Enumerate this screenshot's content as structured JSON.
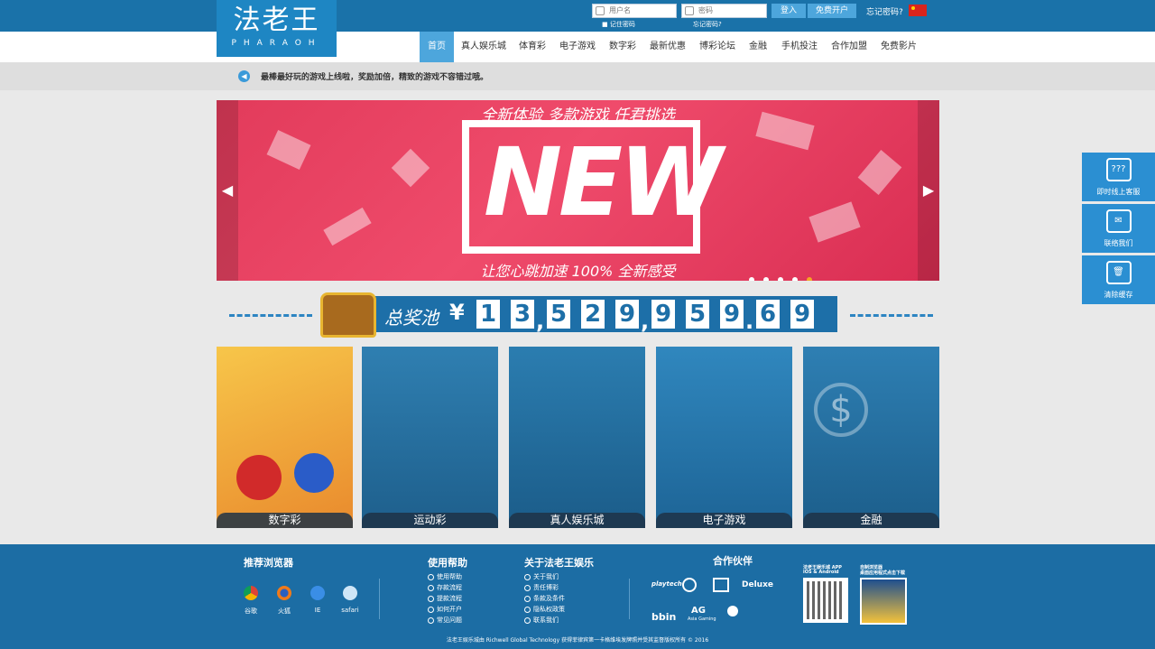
{
  "header": {
    "logo_cn": "法老王",
    "logo_en": "PHARAOH",
    "username_placeholder": "用户名",
    "password_placeholder": "密码",
    "remember": "记住密码",
    "forgot_small": "忘记密码?",
    "login": "登入",
    "register": "免费开户",
    "forgot": "忘记密码?"
  },
  "nav": [
    "首页",
    "真人娱乐城",
    "体育彩",
    "电子游戏",
    "数字彩",
    "最新优惠",
    "博彩论坛",
    "金融",
    "手机投注",
    "合作加盟",
    "免费影片"
  ],
  "notice": "最棒最好玩的游戏上线啦，奖励加倍，精致的游戏不容错过哦。",
  "banner": {
    "slogan_top": "全新体验 多款游戏 任君挑选",
    "big": "NEW",
    "slogan_bottom": "让您心跳加速 100% 全新感受",
    "slides": 5,
    "active_slide": 5
  },
  "jackpot": {
    "label": "总奖池",
    "currency": "¥",
    "digits": [
      "1",
      "3",
      "5",
      "2",
      "9",
      "9",
      "5",
      "9",
      "6",
      "9"
    ],
    "sep1": ",",
    "sep2": ",",
    "sep3": "."
  },
  "categories": [
    "数字彩",
    "运动彩",
    "真人娱乐城",
    "电子游戏",
    "金融"
  ],
  "sidebar": [
    "即时线上客服",
    "联络我们",
    "清除缓存"
  ],
  "footer": {
    "browsers_title": "推荐浏览器",
    "browsers": [
      "谷歌",
      "火狐",
      "IE",
      "safari"
    ],
    "help_title": "使用帮助",
    "help": [
      "使用帮助",
      "存款流程",
      "提款流程",
      "如何开户",
      "常见问题"
    ],
    "about_title": "关于法老王娱乐",
    "about": [
      "关于我们",
      "责任博彩",
      "条款及条件",
      "隐私权政策",
      "联系我们"
    ],
    "partners_title": "合作伙伴",
    "partners": [
      "playtech",
      "",
      "",
      "Deluxe",
      "bbin",
      "AG",
      "Asia Gaming"
    ],
    "app_text1": "法老王娱乐城 APP",
    "app_text2": "iOS & Android",
    "app2_text1": "自制浏览器",
    "app2_text2": "桌面应用程式点击下载",
    "copyright": "法老王娱乐城由 Richwell Global Technology 获得菲律宾第一卡格维埃发牌照并受其监督版权所有 © 2016",
    "colors": {
      "bg": "#1c6da4",
      "accent": "#4da6dc"
    }
  }
}
